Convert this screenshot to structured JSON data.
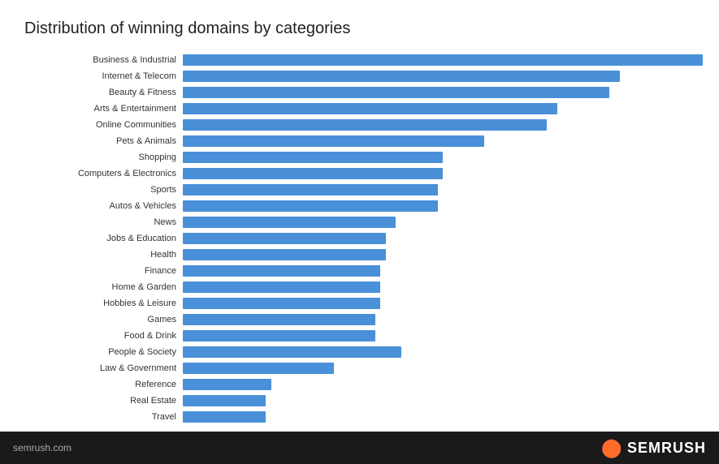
{
  "title": "Distribution of winning domains by categories",
  "footer": {
    "url": "semrush.com",
    "brand": "SEMRUSH"
  },
  "bar_color": "#4a90d9",
  "max_bar_width": 100,
  "categories": [
    {
      "label": "Business & Industrial",
      "value": 100
    },
    {
      "label": "Internet & Telecom",
      "value": 84
    },
    {
      "label": "Beauty & Fitness",
      "value": 82
    },
    {
      "label": "Arts & Entertainment",
      "value": 72
    },
    {
      "label": "Online Communities",
      "value": 70
    },
    {
      "label": "Pets & Animals",
      "value": 58
    },
    {
      "label": "Shopping",
      "value": 50
    },
    {
      "label": "Computers & Electronics",
      "value": 50
    },
    {
      "label": "Sports",
      "value": 49
    },
    {
      "label": "Autos & Vehicles",
      "value": 49
    },
    {
      "label": "News",
      "value": 41
    },
    {
      "label": "Jobs & Education",
      "value": 39
    },
    {
      "label": "Health",
      "value": 39
    },
    {
      "label": "Finance",
      "value": 38
    },
    {
      "label": "Home & Garden",
      "value": 38
    },
    {
      "label": "Hobbies & Leisure",
      "value": 38
    },
    {
      "label": "Games",
      "value": 37
    },
    {
      "label": "Food & Drink",
      "value": 37
    },
    {
      "label": "People & Society",
      "value": 42
    },
    {
      "label": "Law & Government",
      "value": 29
    },
    {
      "label": "Reference",
      "value": 17
    },
    {
      "label": "Real Estate",
      "value": 16
    },
    {
      "label": "Travel",
      "value": 16
    }
  ]
}
